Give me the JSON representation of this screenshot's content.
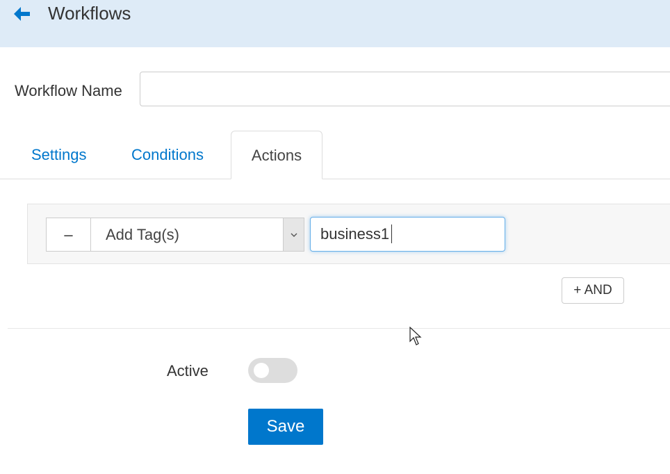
{
  "header": {
    "title": "Workflows",
    "back_icon": "arrow-left-icon",
    "background": "#deebf7"
  },
  "form": {
    "workflow_name_label": "Workflow Name",
    "workflow_name_value": ""
  },
  "tabs": [
    {
      "label": "Settings",
      "active": false
    },
    {
      "label": "Conditions",
      "active": false
    },
    {
      "label": "Actions",
      "active": true
    }
  ],
  "action_row": {
    "remove_label": "–",
    "action_type": "Add Tag(s)",
    "tag_value": "business1",
    "add_and_label": "+ AND"
  },
  "footer": {
    "active_label": "Active",
    "active_on": false,
    "save_label": "Save"
  },
  "colors": {
    "accent": "#0077cc",
    "header_bg": "#deebf7"
  }
}
